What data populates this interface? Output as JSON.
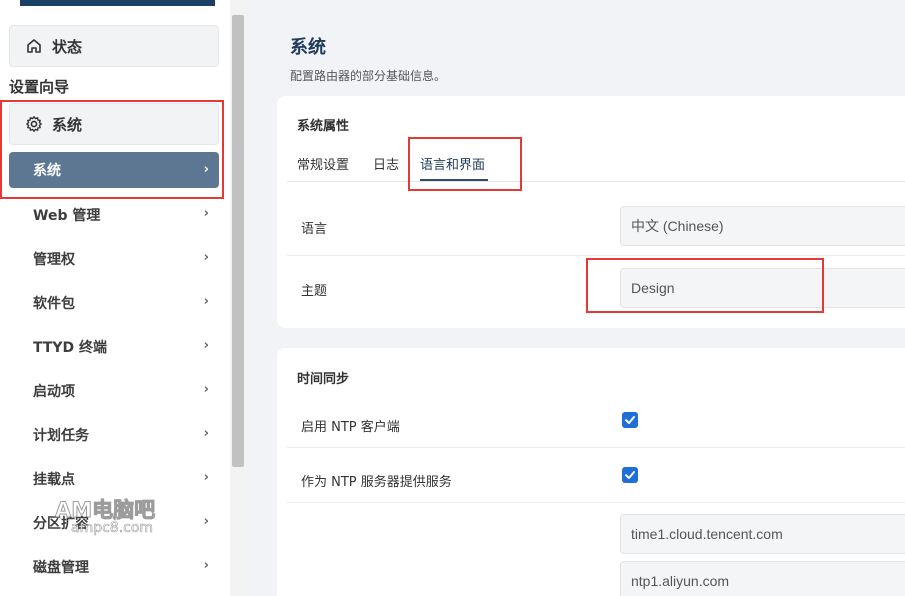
{
  "sidebar": {
    "status_label": "状态",
    "setup_wizard_label": "设置向导",
    "system_label": "系统",
    "active_sub_label": "系统",
    "items": [
      {
        "label": "Web 管理"
      },
      {
        "label": "管理权"
      },
      {
        "label": "软件包"
      },
      {
        "label": "TTYD 终端"
      },
      {
        "label": "启动项"
      },
      {
        "label": "计划任务"
      },
      {
        "label": "挂载点"
      },
      {
        "label": "分区扩容"
      },
      {
        "label": "磁盘管理"
      }
    ],
    "chevron": "›"
  },
  "main": {
    "title": "系统",
    "description": "配置路由器的部分基础信息。",
    "properties_card": {
      "title": "系统属性",
      "tabs": [
        {
          "label": "常规设置",
          "active": false
        },
        {
          "label": "日志",
          "active": false
        },
        {
          "label": "语言和界面",
          "active": true
        }
      ],
      "language_label": "语言",
      "language_value": "中文 (Chinese)",
      "theme_label": "主题",
      "theme_value": "Design"
    },
    "time_card": {
      "title": "时间同步",
      "ntp_client_label": "启用 NTP 客户端",
      "ntp_client_checked": true,
      "ntp_server_label": "作为 NTP 服务器提供服务",
      "ntp_server_checked": true,
      "servers": [
        "time1.cloud.tencent.com",
        "ntp1.aliyun.com"
      ]
    }
  },
  "watermark": {
    "text": "AM电脑吧",
    "sub": "ampc8.com"
  },
  "colors": {
    "active_item_bg": "#5d7792",
    "highlight": "#e53935",
    "checkbox": "#1f6fd6",
    "title": "#1f3a5a"
  }
}
